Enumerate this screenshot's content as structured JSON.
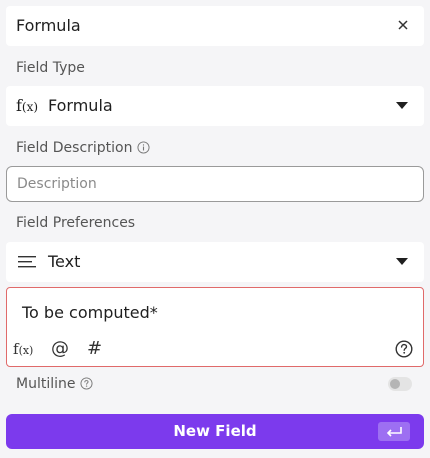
{
  "field_name": "Formula",
  "field_type": {
    "label": "Field Type",
    "fx_symbol": "f",
    "fx_args": "(x)",
    "selected": "Formula"
  },
  "description": {
    "label": "Field Description",
    "placeholder": "Description"
  },
  "preferences": {
    "label": "Field Preferences",
    "selected": "Text"
  },
  "formula": {
    "text": "To be computed*",
    "tool_fx_symbol": "f",
    "tool_fx_args": "(x)",
    "tool_mention": "@",
    "tool_number": "#"
  },
  "multiline": {
    "label": "Multiline",
    "enabled": false
  },
  "submit": {
    "label": "New Field"
  },
  "colors": {
    "accent": "#7c3aed",
    "error_border": "#e06a6a"
  },
  "icons": [
    "close-icon",
    "info-icon",
    "chevron-down-icon",
    "menu-lines-icon",
    "help-circle-icon",
    "enter-key-icon"
  ]
}
